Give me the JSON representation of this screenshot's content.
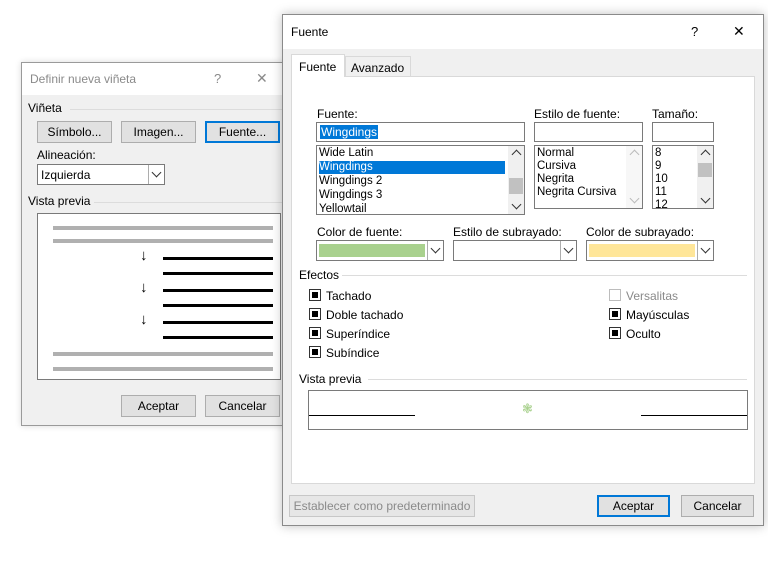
{
  "bullet_dialog": {
    "title": "Definir nueva viñeta",
    "help_glyph": "?",
    "close_glyph": "✕",
    "section_label": "Viñeta",
    "symbol_button": "Símbolo...",
    "image_button": "Imagen...",
    "font_button": "Fuente...",
    "alignment_label": "Alineación:",
    "alignment_value": "Izquierda",
    "preview_label": "Vista previa",
    "preview_bullet_glyph": "↓",
    "ok_button": "Aceptar",
    "cancel_button": "Cancelar"
  },
  "font_dialog": {
    "title": "Fuente",
    "help_glyph": "?",
    "close_glyph": "✕",
    "tabs": [
      {
        "label": "Fuente",
        "active": true
      },
      {
        "label": "Avanzado",
        "active": false
      }
    ],
    "font_label": "Fuente:",
    "font_value": "Wingdings",
    "font_list": [
      "Wide Latin",
      "Wingdings",
      "Wingdings 2",
      "Wingdings 3",
      "Yellowtail"
    ],
    "font_selected": "Wingdings",
    "style_label": "Estilo de fuente:",
    "style_value": "",
    "style_list": [
      "Normal",
      "Cursiva",
      "Negrita",
      "Negrita Cursiva"
    ],
    "size_label": "Tamaño:",
    "size_value": "",
    "size_list": [
      "8",
      "9",
      "10",
      "11",
      "12"
    ],
    "font_color_label": "Color de fuente:",
    "font_color": "#a9d18e",
    "underline_style_label": "Estilo de subrayado:",
    "underline_color_label": "Color de subrayado:",
    "underline_color": "#ffe699",
    "effects_label": "Efectos",
    "effects": [
      {
        "label": "Tachado",
        "state": "indeterminate",
        "enabled": true
      },
      {
        "label": "Doble tachado",
        "state": "indeterminate",
        "enabled": true
      },
      {
        "label": "Superíndice",
        "state": "indeterminate",
        "enabled": true
      },
      {
        "label": "Subíndice",
        "state": "indeterminate",
        "enabled": true
      }
    ],
    "effects_right": [
      {
        "label": "Versalitas",
        "state": "unchecked",
        "enabled": false
      },
      {
        "label": "Mayúsculas",
        "state": "indeterminate",
        "enabled": true
      },
      {
        "label": "Oculto",
        "state": "indeterminate",
        "enabled": true
      }
    ],
    "preview_label": "Vista previa",
    "preview_glyph": "❃",
    "default_button": "Establecer como predeterminado",
    "ok_button": "Aceptar",
    "cancel_button": "Cancelar",
    "accent_color": "#0078d7"
  }
}
